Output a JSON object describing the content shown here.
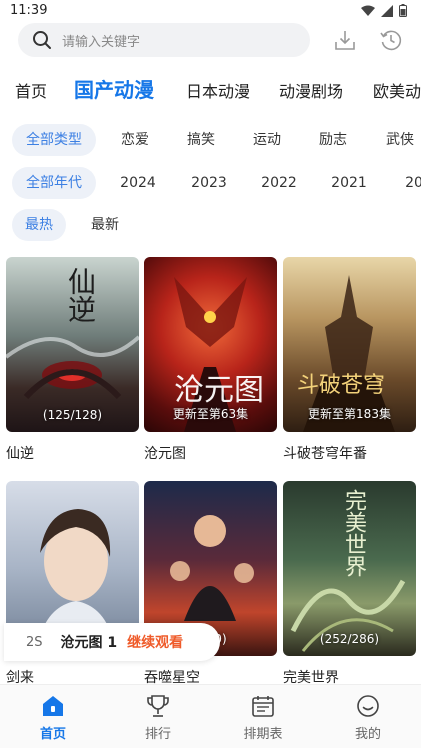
{
  "status_bar": {
    "time": "11:39"
  },
  "search": {
    "placeholder": "请输入关键字"
  },
  "category_tabs": [
    {
      "label": "首页"
    },
    {
      "label": "国产动漫"
    },
    {
      "label": "日本动漫"
    },
    {
      "label": "动漫剧场"
    },
    {
      "label": "欧美动"
    }
  ],
  "genre_filters": [
    {
      "label": "全部类型"
    },
    {
      "label": "恋爱"
    },
    {
      "label": "搞笑"
    },
    {
      "label": "运动"
    },
    {
      "label": "励志"
    },
    {
      "label": "武侠"
    }
  ],
  "year_filters": [
    {
      "label": "全部年代"
    },
    {
      "label": "2024"
    },
    {
      "label": "2023"
    },
    {
      "label": "2022"
    },
    {
      "label": "2021"
    },
    {
      "label": "20"
    }
  ],
  "sort_filters": [
    {
      "label": "最热"
    },
    {
      "label": "最新"
    }
  ],
  "cards": [
    {
      "title": "仙逆",
      "badge": "(125/128)",
      "poster_text": "仙逆"
    },
    {
      "title": "沧元图",
      "badge": "更新至第63集",
      "poster_text": "沧元图"
    },
    {
      "title": "斗破苍穹年番",
      "badge": "更新至第183集",
      "poster_text": "斗破苍穹"
    },
    {
      "title": "剑来",
      "badge": "",
      "poster_text": ""
    },
    {
      "title": "吞噬星空",
      "badge": "(160)",
      "poster_text": ""
    },
    {
      "title": "完美世界",
      "badge": "(252/286)",
      "poster_text": "完美世界"
    }
  ],
  "continue_watching": {
    "episode": "2S",
    "title": "沧元图 1",
    "action": "继续观看"
  },
  "bottom_nav": [
    {
      "label": "首页"
    },
    {
      "label": "排行"
    },
    {
      "label": "排期表"
    },
    {
      "label": "我的"
    }
  ],
  "colors": {
    "accent": "#1677e8",
    "resume_action": "#ef5b2a",
    "chip_bg": "#edf1f8"
  }
}
